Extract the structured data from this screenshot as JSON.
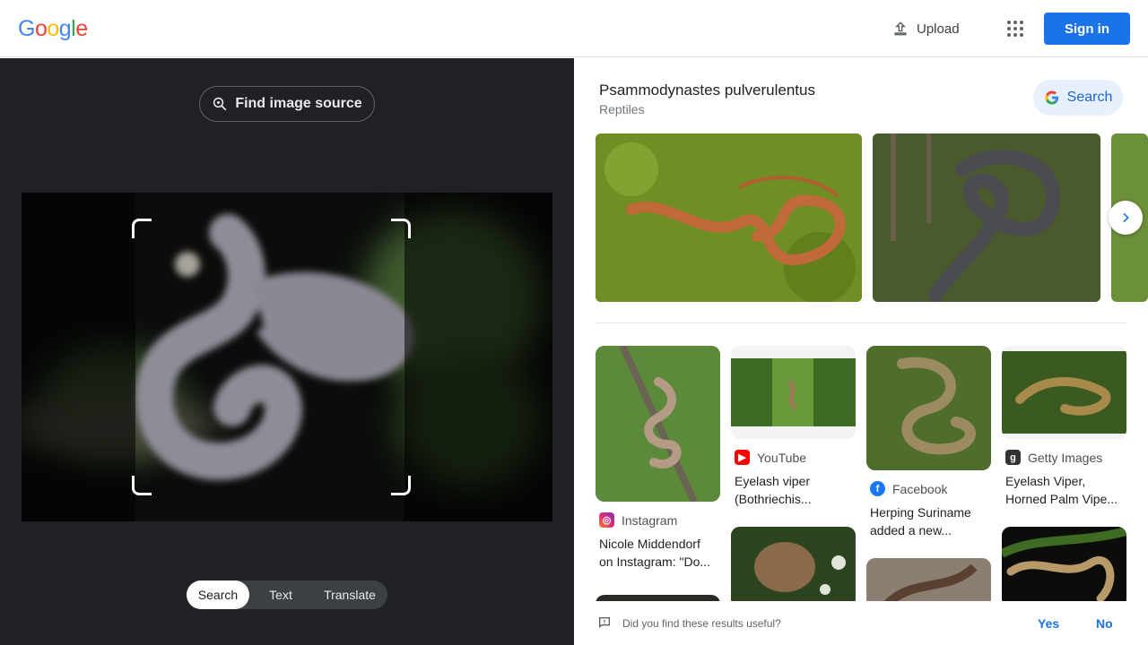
{
  "header": {
    "logo_letters": [
      "G",
      "o",
      "o",
      "g",
      "l",
      "e"
    ],
    "logo_colors": [
      "#4285F4",
      "#EA4335",
      "#FBBC05",
      "#4285F4",
      "#34A853",
      "#EA4335"
    ],
    "upload_label": "Upload",
    "signin_label": "Sign in"
  },
  "lens": {
    "find_source_label": "Find image source",
    "tabs": [
      {
        "label": "Search",
        "active": true
      },
      {
        "label": "Text",
        "active": false
      },
      {
        "label": "Translate",
        "active": false
      }
    ]
  },
  "result": {
    "title": "Psammodynastes pulverulentus",
    "subtitle": "Reptiles",
    "search_label": "Search"
  },
  "cards": [
    {
      "source": "Instagram",
      "icon": "instagram-icon",
      "title_line1": "Nicole Middendorf",
      "title_line2": "on Instagram: \"Do..."
    },
    {
      "source": "YouTube",
      "icon": "youtube-icon",
      "title_line1": "Eyelash viper",
      "title_line2": "(Bothriechis..."
    },
    {
      "source": "Facebook",
      "icon": "facebook-icon",
      "title_line1": "Herping Suriname",
      "title_line2": "added a new..."
    },
    {
      "source": "Getty Images",
      "icon": "getty-icon",
      "title_line1": "Eyelash Viper,",
      "title_line2": "Horned Palm Vipe..."
    }
  ],
  "feedback": {
    "question": "Did you find these results useful?",
    "yes": "Yes",
    "no": "No"
  },
  "colors": {
    "accent": "#1a73e8",
    "dark_bg": "#202124"
  }
}
